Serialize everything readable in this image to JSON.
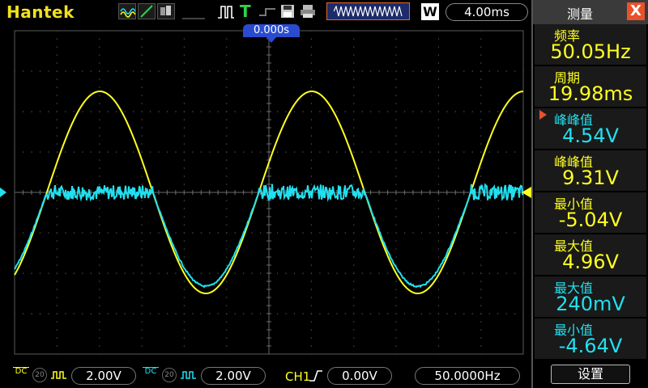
{
  "topbar": {
    "brand": "Hantek",
    "trigger_letter": "T",
    "window_label": "W",
    "timebase": "4.00ms",
    "icons": [
      "waveform-mode-icon",
      "run-icon",
      "trigger-icon",
      "save-icon",
      "print-icon",
      "wave-window-icon"
    ]
  },
  "scope": {
    "trigger_position": "0.000s",
    "colors": {
      "ch1": "#ffff20",
      "ch2": "#20e0f0",
      "grid": "#5a5a5a",
      "trigger_marker": "#2a4bd0"
    }
  },
  "panel": {
    "title": "测量",
    "close_label": "X",
    "measurements": [
      {
        "label": "频率",
        "value": "50.05Hz",
        "color": "yellow",
        "selected": false
      },
      {
        "label": "周期",
        "value": "19.98ms",
        "color": "yellow",
        "selected": false
      },
      {
        "label": "峰峰值",
        "value": "4.54V",
        "color": "cyan",
        "selected": true
      },
      {
        "label": "峰峰值",
        "value": "9.31V",
        "color": "yellow",
        "selected": false
      },
      {
        "label": "最小值",
        "value": "-5.04V",
        "color": "yellow",
        "selected": false
      },
      {
        "label": "最大值",
        "value": "4.96V",
        "color": "yellow",
        "selected": false
      },
      {
        "label": "最大值",
        "value": "240mV",
        "color": "cyan",
        "selected": false
      },
      {
        "label": "最小值",
        "value": "-4.64V",
        "color": "cyan",
        "selected": false
      }
    ],
    "settings_label": "设置"
  },
  "bottombar": {
    "ch1_coupling": "DC",
    "ch1_bw": "20",
    "ch1_volts": "2.00V",
    "ch2_coupling": "DC",
    "ch2_bw": "20",
    "ch2_volts": "2.00V",
    "trigger_source": "CH1",
    "trigger_level": "0.00V",
    "frequency": "50.0000Hz"
  }
}
